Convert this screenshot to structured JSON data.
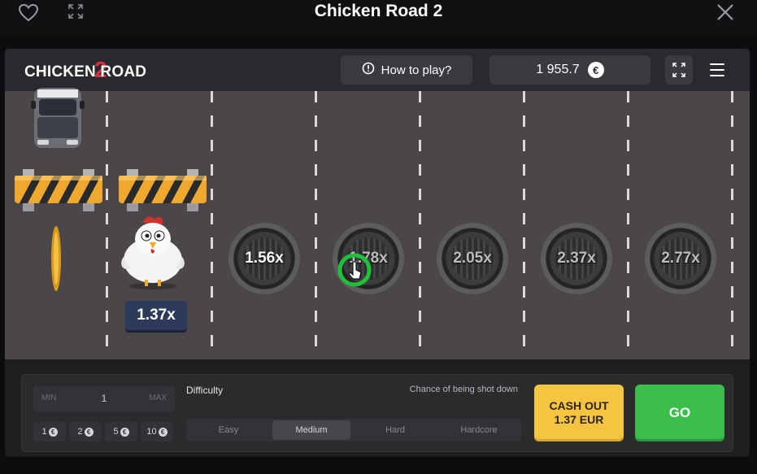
{
  "window": {
    "title": "Chicken Road 2"
  },
  "header": {
    "logo_text": "CHICKEN ROAD",
    "logo_number": "2",
    "how_to_play": "How to play?",
    "balance": "1 955.7",
    "currency_symbol": "€"
  },
  "road": {
    "current_multiplier": "1.37x",
    "multipliers": [
      "1.56x",
      "1.78x",
      "2.05x",
      "2.37x",
      "2.77x"
    ]
  },
  "controls": {
    "bet_min_label": "MIN",
    "bet_value": "1",
    "bet_max_label": "MAX",
    "chips": [
      "1",
      "2",
      "5",
      "10"
    ],
    "chip_currency": "€",
    "difficulty_label": "Difficulty",
    "chance_label": "Chance of being shot down",
    "difficulty_options": [
      "Easy",
      "Medium",
      "Hard",
      "Hardcore"
    ],
    "difficulty_selected": "Medium",
    "cashout_line1": "CASH OUT",
    "cashout_line2": "1.37 EUR",
    "go_label": "GO"
  },
  "colors": {
    "accent_yellow": "#f5c542",
    "go_green": "#3bbe4c",
    "logo_red": "#d5303e",
    "multiplier_badge": "#2d3a5a"
  },
  "icons": [
    "heart-icon",
    "expand-icon",
    "close-icon",
    "info-icon",
    "euro-icon",
    "fullscreen-icon",
    "menu-icon"
  ]
}
